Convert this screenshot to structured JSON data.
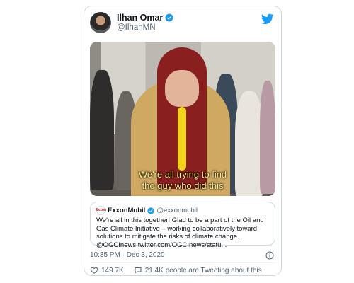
{
  "tweet": {
    "display_name": "Ilhan Omar",
    "handle": "@IlhanMN",
    "video_caption_line1": "We're all trying to find",
    "video_caption_line2": "the guy who did this",
    "timestamp": "10:35 PM · Dec 3, 2020",
    "likes": "149.7K",
    "conversation_label": "21.4K people are Tweeting about this"
  },
  "quoted_tweet": {
    "display_name": "ExxonMobil",
    "handle": "@exxonmobil",
    "logo_text": "Exxon",
    "text": "We're all in this together! Glad to be a part of the Oil and Gas Climate Initiative – working collaboratively toward solutions to mitigate the risks of climate change. @OGCInews twitter.com/OGCInews/statu..."
  },
  "colors": {
    "twitter_blue": "#1d9bf0",
    "verified_blue": "#1d9bf0",
    "caption_yellow": "#ffe98a",
    "exxon_red": "#d2232a"
  },
  "icons": [
    "verified-badge-icon",
    "twitter-bird-icon",
    "info-icon",
    "heart-icon",
    "chat-bubble-icon"
  ]
}
